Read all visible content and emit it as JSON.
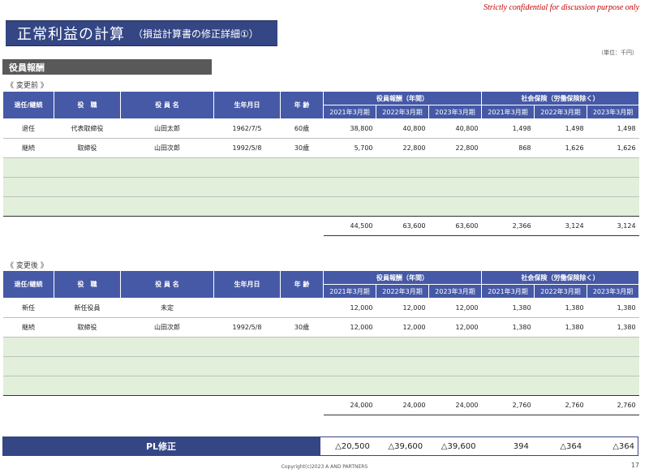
{
  "confidential": "Strictly confidential for discussion purpose only",
  "title": {
    "main": "正常利益の計算",
    "sub": "（損益計算書の修正詳細①）"
  },
  "unit": "（単位：千円）",
  "section": "役員報酬",
  "columns": {
    "h1": [
      "退任/継続",
      "役　職",
      "役 員 名",
      "生年月日",
      "年 齢"
    ],
    "group_comp": "役員報酬（年間）",
    "group_social": "社会保険（労働保険除く）",
    "years": [
      "2021年3月期",
      "2022年3月期",
      "2023年3月期",
      "2021年3月期",
      "2022年3月期",
      "2023年3月期"
    ]
  },
  "before": {
    "label": "《 変更前 》",
    "rows": [
      [
        "退任",
        "代表取締役",
        "山田太郎",
        "1962/7/5",
        "60歳",
        "38,800",
        "40,800",
        "40,800",
        "1,498",
        "1,498",
        "1,498"
      ],
      [
        "継続",
        "取締役",
        "山田次郎",
        "1992/5/8",
        "30歳",
        "5,700",
        "22,800",
        "22,800",
        "868",
        "1,626",
        "1,626"
      ]
    ],
    "totals": [
      "44,500",
      "63,600",
      "63,600",
      "2,366",
      "3,124",
      "3,124"
    ]
  },
  "after": {
    "label": "《 変更後 》",
    "rows": [
      [
        "新任",
        "新任役員",
        "未定",
        "",
        "",
        "12,000",
        "12,000",
        "12,000",
        "1,380",
        "1,380",
        "1,380"
      ],
      [
        "継続",
        "取締役",
        "山田次郎",
        "1992/5/8",
        "30歳",
        "12,000",
        "12,000",
        "12,000",
        "1,380",
        "1,380",
        "1,380"
      ]
    ],
    "totals": [
      "24,000",
      "24,000",
      "24,000",
      "2,760",
      "2,760",
      "2,760"
    ]
  },
  "pl": {
    "label": "PL修正",
    "values": [
      "△20,500",
      "△39,600",
      "△39,600",
      "394",
      "△364",
      "△364"
    ]
  },
  "footer": "Copyright(c)2023  A AND PARTNERS",
  "page": "17"
}
